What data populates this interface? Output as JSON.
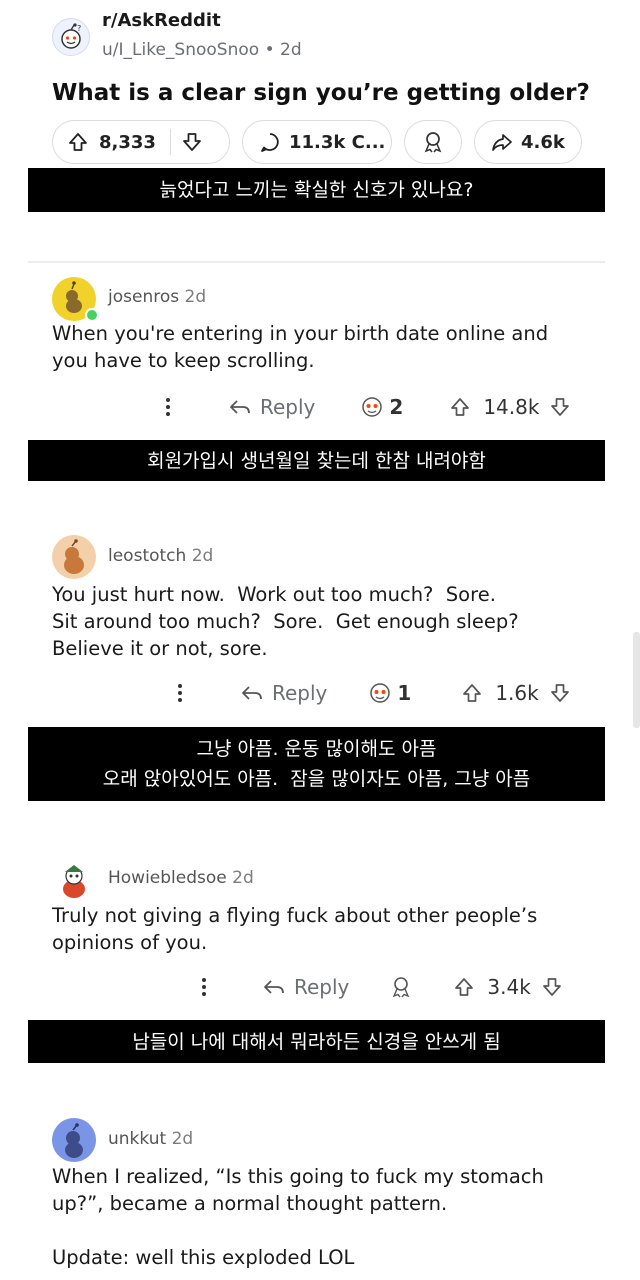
{
  "post": {
    "subreddit": "r/AskReddit",
    "user": "u/I_Like_SnooSnoo",
    "age": "2d",
    "title": "What is a clear sign you’re getting older?",
    "upvotes": "8,333",
    "comments": "11.3k C...",
    "shares": "4.6k",
    "caption_ko": "늙었다고 느끼는 확실한 신호가 있나요?"
  },
  "comments": [
    {
      "user": "josenros",
      "age": "2d",
      "body": [
        "When you're entering in your birth date online and",
        "you have to keep scrolling."
      ],
      "reply_label": "Reply",
      "awards": "2",
      "votes": "14.8k",
      "caption_ko": [
        "회원가입시 생년월일 찾는데 한참 내려야함"
      ]
    },
    {
      "user": "leostotch",
      "age": "2d",
      "body": [
        "You just hurt now.  Work out too much?  Sore.",
        "Sit around too much?  Sore.  Get enough sleep?",
        "Believe it or not, sore."
      ],
      "reply_label": "Reply",
      "awards": "1",
      "votes": "1.6k",
      "caption_ko": [
        "그냥 아픔. 운동 많이해도 아픔",
        "오래 앉아있어도 아픔.  잠을 많이자도 아픔, 그냥 아픔"
      ]
    },
    {
      "user": "Howiebledsoe",
      "age": "2d",
      "body": [
        "Truly not giving a flying fuck about other people’s",
        "opinions of you."
      ],
      "reply_label": "Reply",
      "votes": "3.4k",
      "caption_ko": [
        "남들이 나에 대해서 뭐라하든 신경을 안쓰게 됨"
      ]
    },
    {
      "user": "unkkut",
      "age": "2d",
      "body": [
        "When I realized, “Is this going to fuck my stomach",
        "up?”, became a normal thought pattern.",
        "",
        "Update: well this exploded LOL"
      ]
    }
  ],
  "colors": {
    "caption_bg": "#000000",
    "online_dot": "#46d160",
    "avatar1": "#f1d22b",
    "avatar2": "#e6a25a",
    "avatar4": "#7b95e6"
  },
  "icons": [
    "snoo-avatar-icon",
    "upvote-icon",
    "downvote-icon",
    "comment-icon",
    "award-icon",
    "share-icon",
    "more-icon",
    "reply-icon"
  ]
}
